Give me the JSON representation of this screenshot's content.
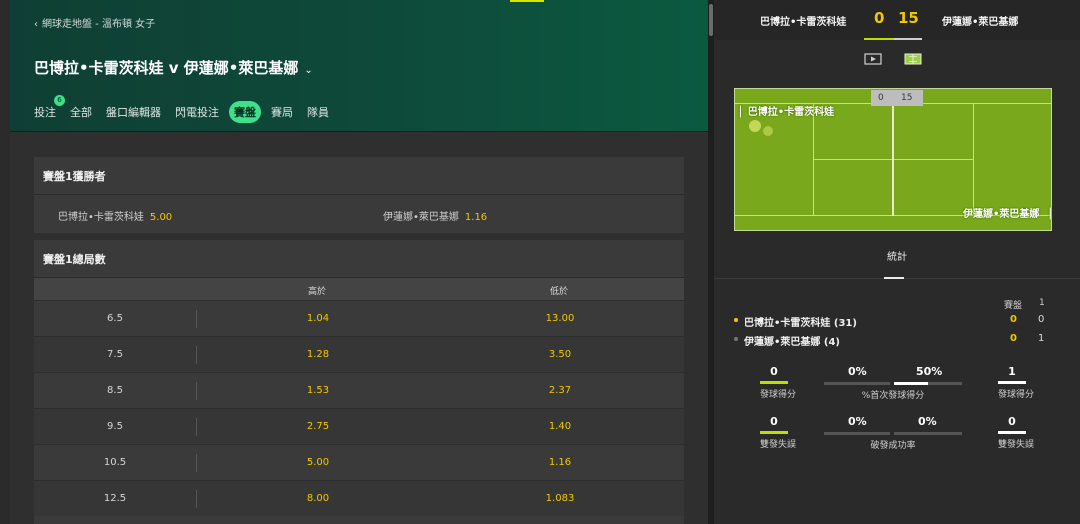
{
  "breadcrumb": "網球走地盤 - 溫布頓 女子",
  "event": {
    "title": "巴博拉•卡雷茨科娃 v 伊蓮娜•萊巴基娜"
  },
  "tabs": [
    {
      "label": "投注",
      "badge": "6"
    },
    {
      "label": "全部"
    },
    {
      "label": "盤口編輯器"
    },
    {
      "label": "閃電投注"
    },
    {
      "label": "賽盤",
      "active": true
    },
    {
      "label": "賽局"
    },
    {
      "label": "隊員"
    }
  ],
  "set_winner": {
    "title": "賽盤1獲勝者",
    "p1": {
      "name": "巴博拉•卡雷茨科娃",
      "odds": "5.00"
    },
    "p2": {
      "name": "伊蓮娜•萊巴基娜",
      "odds": "1.16"
    }
  },
  "total_games": {
    "title": "賽盤1總局數",
    "col_over": "高於",
    "col_under": "低於",
    "rows": [
      {
        "line": "6.5",
        "over": "1.04",
        "under": "13.00"
      },
      {
        "line": "7.5",
        "over": "1.28",
        "under": "3.50"
      },
      {
        "line": "8.5",
        "over": "1.53",
        "under": "2.37"
      },
      {
        "line": "9.5",
        "over": "2.75",
        "under": "1.40"
      },
      {
        "line": "10.5",
        "over": "5.00",
        "under": "1.16"
      },
      {
        "line": "12.5",
        "over": "8.00",
        "under": "1.083"
      }
    ]
  },
  "scoreboard": {
    "p1": "巴博拉•卡雷茨科娃",
    "p2": "伊蓮娜•萊巴基娜",
    "score1": "0",
    "score2": "15"
  },
  "court": {
    "score1": "0",
    "score2": "15",
    "p1_label": "巴博拉•卡雷茨科娃",
    "p2_label": "伊蓮娜•萊巴基娜"
  },
  "stats": {
    "tab_label": "統計",
    "set_header": "賽盤",
    "set_number": "1",
    "p1": {
      "name": "巴博拉•卡雷茨科娃 (31)",
      "games": "0",
      "set1": "0"
    },
    "p2": {
      "name": "伊蓮娜•萊巴基娜 (4)",
      "games": "0",
      "set1": "1"
    },
    "aces": {
      "p1": "0",
      "p2": "1",
      "p1_label": "發球得分",
      "p2_label": "發球得分"
    },
    "first_serve": {
      "p1": "0%",
      "p2": "50%",
      "label": "%首次發球得分",
      "p1_fraction": 0,
      "p2_fraction": 0.5
    },
    "double_faults": {
      "p1": "0",
      "p2": "0",
      "p1_label": "雙發失誤",
      "p2_label": "雙發失誤"
    },
    "break_points": {
      "p1": "0%",
      "p2": "0%",
      "label": "破發成功率",
      "p1_fraction": 0,
      "p2_fraction": 0
    }
  },
  "colors": {
    "accent": "#3ee08a",
    "odds": "#f0c800",
    "p1": "#f0c800",
    "p2": "#ffffff",
    "court": "#7aa81c",
    "stat_p1": "#b8e000"
  },
  "icons": {
    "video": "play-icon",
    "court": "court-view-icon"
  }
}
